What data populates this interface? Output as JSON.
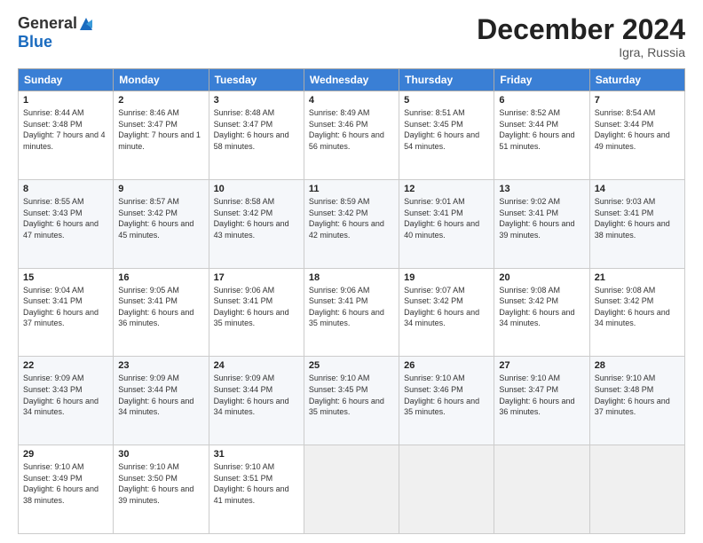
{
  "logo": {
    "general": "General",
    "blue": "Blue"
  },
  "title": "December 2024",
  "location": "Igra, Russia",
  "days_of_week": [
    "Sunday",
    "Monday",
    "Tuesday",
    "Wednesday",
    "Thursday",
    "Friday",
    "Saturday"
  ],
  "weeks": [
    [
      {
        "day": "1",
        "sunrise": "Sunrise: 8:44 AM",
        "sunset": "Sunset: 3:48 PM",
        "daylight": "Daylight: 7 hours and 4 minutes."
      },
      {
        "day": "2",
        "sunrise": "Sunrise: 8:46 AM",
        "sunset": "Sunset: 3:47 PM",
        "daylight": "Daylight: 7 hours and 1 minute."
      },
      {
        "day": "3",
        "sunrise": "Sunrise: 8:48 AM",
        "sunset": "Sunset: 3:47 PM",
        "daylight": "Daylight: 6 hours and 58 minutes."
      },
      {
        "day": "4",
        "sunrise": "Sunrise: 8:49 AM",
        "sunset": "Sunset: 3:46 PM",
        "daylight": "Daylight: 6 hours and 56 minutes."
      },
      {
        "day": "5",
        "sunrise": "Sunrise: 8:51 AM",
        "sunset": "Sunset: 3:45 PM",
        "daylight": "Daylight: 6 hours and 54 minutes."
      },
      {
        "day": "6",
        "sunrise": "Sunrise: 8:52 AM",
        "sunset": "Sunset: 3:44 PM",
        "daylight": "Daylight: 6 hours and 51 minutes."
      },
      {
        "day": "7",
        "sunrise": "Sunrise: 8:54 AM",
        "sunset": "Sunset: 3:44 PM",
        "daylight": "Daylight: 6 hours and 49 minutes."
      }
    ],
    [
      {
        "day": "8",
        "sunrise": "Sunrise: 8:55 AM",
        "sunset": "Sunset: 3:43 PM",
        "daylight": "Daylight: 6 hours and 47 minutes."
      },
      {
        "day": "9",
        "sunrise": "Sunrise: 8:57 AM",
        "sunset": "Sunset: 3:42 PM",
        "daylight": "Daylight: 6 hours and 45 minutes."
      },
      {
        "day": "10",
        "sunrise": "Sunrise: 8:58 AM",
        "sunset": "Sunset: 3:42 PM",
        "daylight": "Daylight: 6 hours and 43 minutes."
      },
      {
        "day": "11",
        "sunrise": "Sunrise: 8:59 AM",
        "sunset": "Sunset: 3:42 PM",
        "daylight": "Daylight: 6 hours and 42 minutes."
      },
      {
        "day": "12",
        "sunrise": "Sunrise: 9:01 AM",
        "sunset": "Sunset: 3:41 PM",
        "daylight": "Daylight: 6 hours and 40 minutes."
      },
      {
        "day": "13",
        "sunrise": "Sunrise: 9:02 AM",
        "sunset": "Sunset: 3:41 PM",
        "daylight": "Daylight: 6 hours and 39 minutes."
      },
      {
        "day": "14",
        "sunrise": "Sunrise: 9:03 AM",
        "sunset": "Sunset: 3:41 PM",
        "daylight": "Daylight: 6 hours and 38 minutes."
      }
    ],
    [
      {
        "day": "15",
        "sunrise": "Sunrise: 9:04 AM",
        "sunset": "Sunset: 3:41 PM",
        "daylight": "Daylight: 6 hours and 37 minutes."
      },
      {
        "day": "16",
        "sunrise": "Sunrise: 9:05 AM",
        "sunset": "Sunset: 3:41 PM",
        "daylight": "Daylight: 6 hours and 36 minutes."
      },
      {
        "day": "17",
        "sunrise": "Sunrise: 9:06 AM",
        "sunset": "Sunset: 3:41 PM",
        "daylight": "Daylight: 6 hours and 35 minutes."
      },
      {
        "day": "18",
        "sunrise": "Sunrise: 9:06 AM",
        "sunset": "Sunset: 3:41 PM",
        "daylight": "Daylight: 6 hours and 35 minutes."
      },
      {
        "day": "19",
        "sunrise": "Sunrise: 9:07 AM",
        "sunset": "Sunset: 3:42 PM",
        "daylight": "Daylight: 6 hours and 34 minutes."
      },
      {
        "day": "20",
        "sunrise": "Sunrise: 9:08 AM",
        "sunset": "Sunset: 3:42 PM",
        "daylight": "Daylight: 6 hours and 34 minutes."
      },
      {
        "day": "21",
        "sunrise": "Sunrise: 9:08 AM",
        "sunset": "Sunset: 3:42 PM",
        "daylight": "Daylight: 6 hours and 34 minutes."
      }
    ],
    [
      {
        "day": "22",
        "sunrise": "Sunrise: 9:09 AM",
        "sunset": "Sunset: 3:43 PM",
        "daylight": "Daylight: 6 hours and 34 minutes."
      },
      {
        "day": "23",
        "sunrise": "Sunrise: 9:09 AM",
        "sunset": "Sunset: 3:44 PM",
        "daylight": "Daylight: 6 hours and 34 minutes."
      },
      {
        "day": "24",
        "sunrise": "Sunrise: 9:09 AM",
        "sunset": "Sunset: 3:44 PM",
        "daylight": "Daylight: 6 hours and 34 minutes."
      },
      {
        "day": "25",
        "sunrise": "Sunrise: 9:10 AM",
        "sunset": "Sunset: 3:45 PM",
        "daylight": "Daylight: 6 hours and 35 minutes."
      },
      {
        "day": "26",
        "sunrise": "Sunrise: 9:10 AM",
        "sunset": "Sunset: 3:46 PM",
        "daylight": "Daylight: 6 hours and 35 minutes."
      },
      {
        "day": "27",
        "sunrise": "Sunrise: 9:10 AM",
        "sunset": "Sunset: 3:47 PM",
        "daylight": "Daylight: 6 hours and 36 minutes."
      },
      {
        "day": "28",
        "sunrise": "Sunrise: 9:10 AM",
        "sunset": "Sunset: 3:48 PM",
        "daylight": "Daylight: 6 hours and 37 minutes."
      }
    ],
    [
      {
        "day": "29",
        "sunrise": "Sunrise: 9:10 AM",
        "sunset": "Sunset: 3:49 PM",
        "daylight": "Daylight: 6 hours and 38 minutes."
      },
      {
        "day": "30",
        "sunrise": "Sunrise: 9:10 AM",
        "sunset": "Sunset: 3:50 PM",
        "daylight": "Daylight: 6 hours and 39 minutes."
      },
      {
        "day": "31",
        "sunrise": "Sunrise: 9:10 AM",
        "sunset": "Sunset: 3:51 PM",
        "daylight": "Daylight: 6 hours and 41 minutes."
      },
      {
        "day": "",
        "sunrise": "",
        "sunset": "",
        "daylight": ""
      },
      {
        "day": "",
        "sunrise": "",
        "sunset": "",
        "daylight": ""
      },
      {
        "day": "",
        "sunrise": "",
        "sunset": "",
        "daylight": ""
      },
      {
        "day": "",
        "sunrise": "",
        "sunset": "",
        "daylight": ""
      }
    ]
  ]
}
